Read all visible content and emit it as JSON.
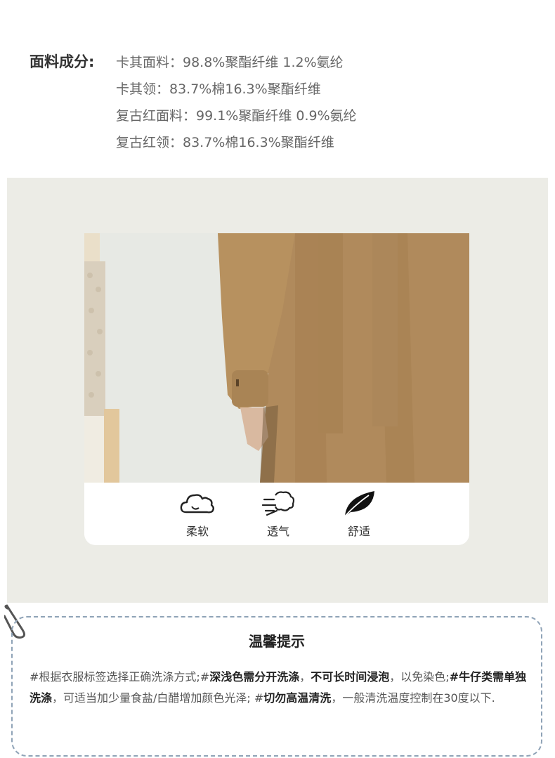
{
  "fabric": {
    "label": "面料成分:",
    "lines": [
      "卡其面料：98.8%聚酯纤维 1.2%氨纶",
      "卡其领：83.7%棉16.3%聚酯纤维",
      "复古红面料：99.1%聚酯纤维 0.9%氨纶",
      "复古红领：83.7%棉16.3%聚酯纤维"
    ]
  },
  "features": [
    {
      "label": "柔软",
      "icon": "cloud-icon"
    },
    {
      "label": "透气",
      "icon": "wind-icon"
    },
    {
      "label": "舒适",
      "icon": "leaf-icon"
    }
  ],
  "tips": {
    "title": "温馨提示",
    "parts": [
      "#根据衣服标签选择正确洗涤方式;#",
      "深浅色需分开洗涤",
      "，",
      "不可长时间浸泡",
      "，以免染色;",
      "#牛仔类需单独洗涤",
      "，可适当加少量食盐/白醋增加颜色光泽; #",
      "切勿高温清洗",
      "，一般清洗温度控制在30度以下."
    ]
  },
  "colors": {
    "panel": "#ecece6",
    "coat": "#b08a5c",
    "tip_border": "#8fa3b7"
  }
}
